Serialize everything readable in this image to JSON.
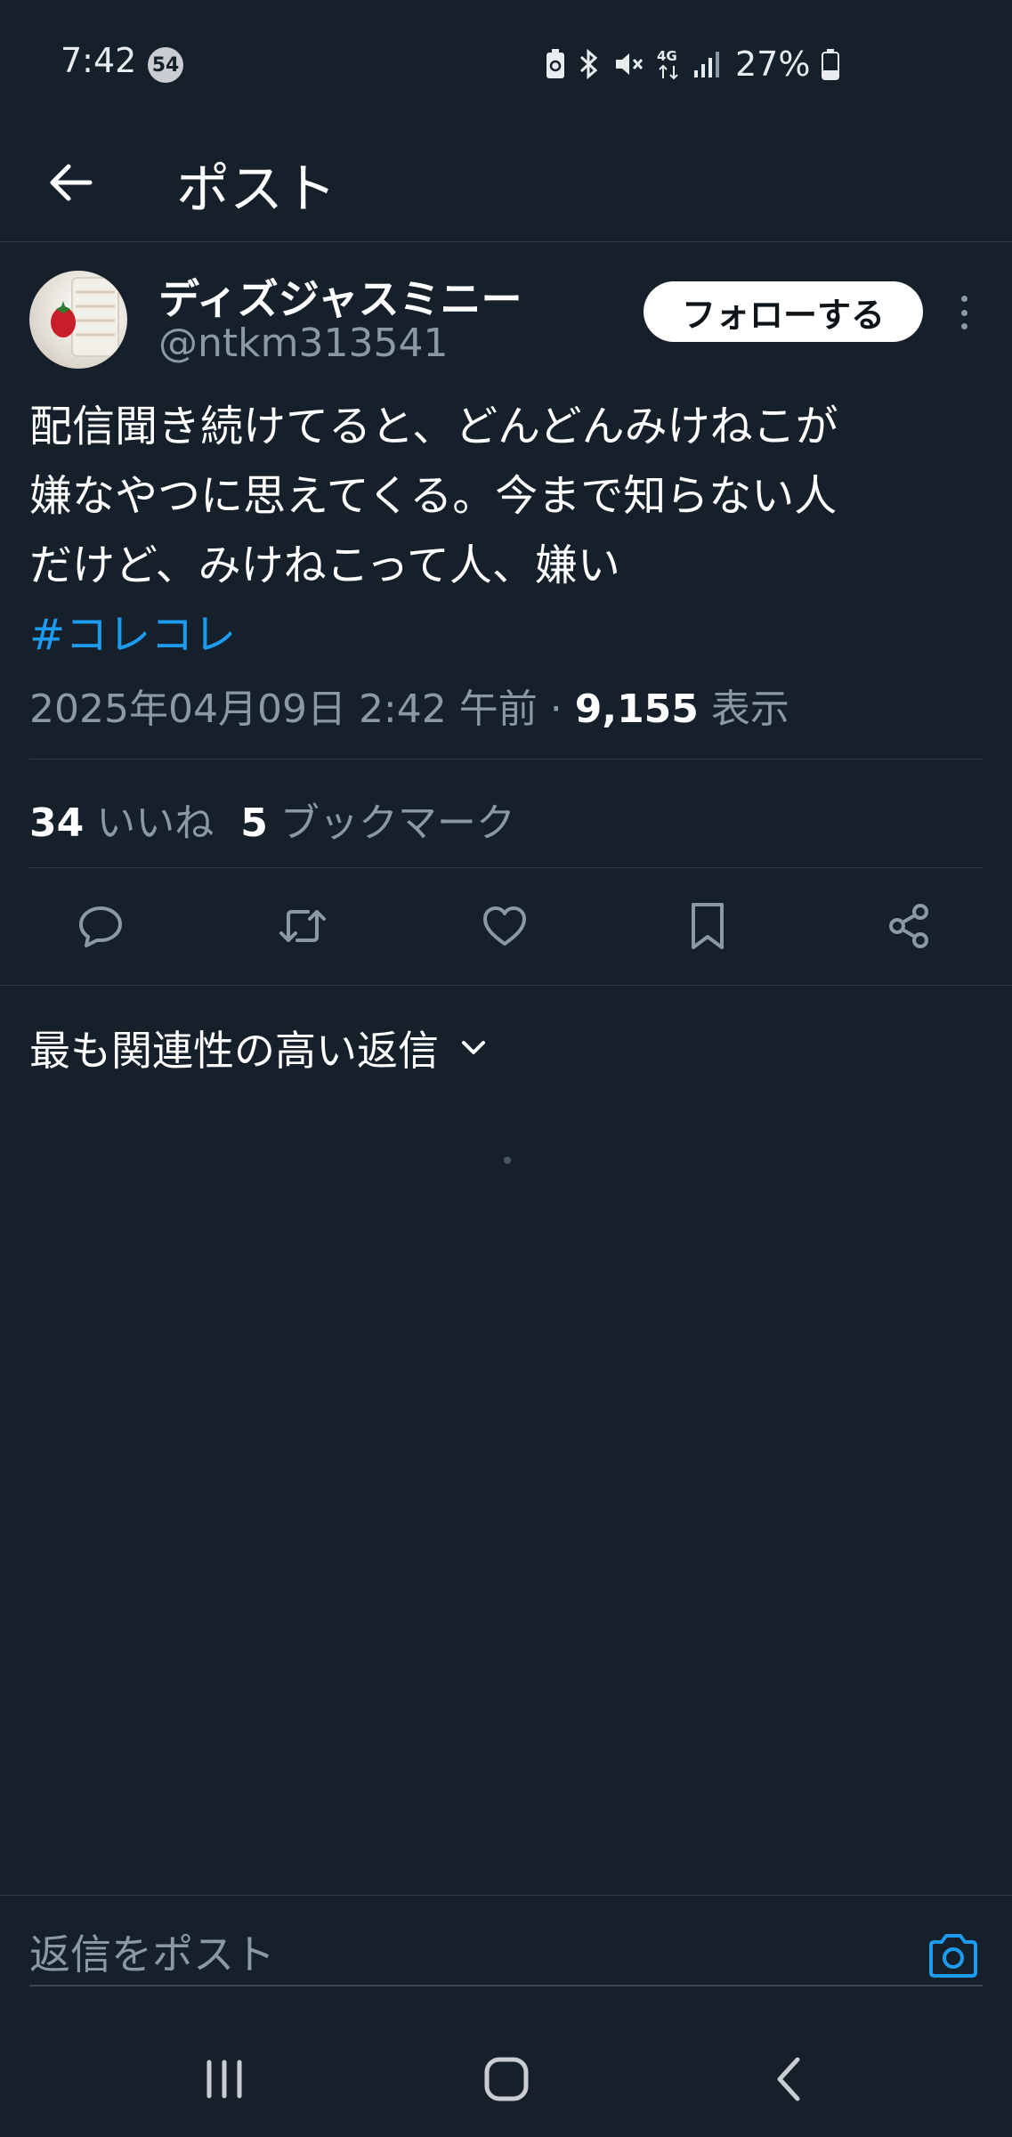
{
  "status_bar": {
    "time": "7:42",
    "notification_count": "54",
    "battery": "27%",
    "network": "4G",
    "icons": [
      "battery-saver-icon",
      "bluetooth-icon",
      "mute-icon",
      "4g-icon",
      "signal-icon",
      "battery-icon"
    ]
  },
  "header": {
    "title": "ポスト",
    "back_icon": "arrow-left-icon"
  },
  "post": {
    "author_name": "ディズジャスミニー",
    "author_handle": "@ntkm313541",
    "follow_label": "フォローする",
    "text_lines": [
      "配信聞き続けてると、どんどんみけねこが",
      "嫌なやつに思えてくる。今まで知らない人",
      "だけど、みけねこって人、嫌い"
    ],
    "hashtag": "#コレコレ",
    "timestamp": "2025年04月09日 2:42 午前",
    "separator": "·",
    "views_count": "9,155",
    "views_label": "表示",
    "likes_count": "34",
    "likes_label": "いいね",
    "bookmarks_count": "5",
    "bookmarks_label": "ブックマーク"
  },
  "actions": [
    "reply-icon",
    "repost-icon",
    "like-icon",
    "bookmark-icon",
    "share-icon"
  ],
  "replies": {
    "sort_label": "最も関連性の高い返信"
  },
  "composer": {
    "placeholder": "返信をポスト"
  },
  "navigation": [
    "recent-apps-icon",
    "home-icon",
    "back-icon"
  ],
  "colors": {
    "background": "#16202a",
    "accent": "#1d9bf0",
    "muted_text": "#8b98a5",
    "divider": "#2f3a44"
  }
}
